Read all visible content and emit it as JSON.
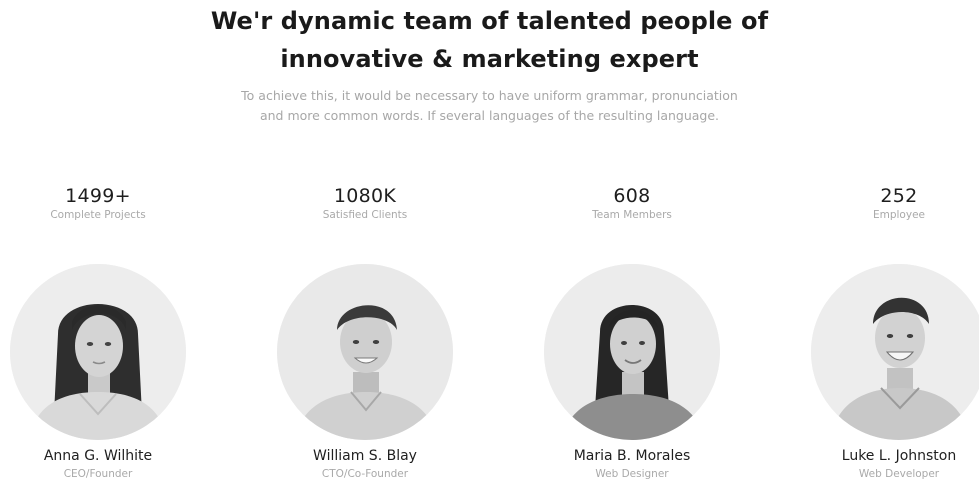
{
  "hero": {
    "title_line1": "We'r dynamic team of talented people of",
    "title_line2": "innovative & marketing expert",
    "subtitle_line1": "To achieve this, it would be necessary to have uniform grammar, pronunciation",
    "subtitle_line2": "and more common words. If several languages of the resulting language."
  },
  "stats": [
    {
      "value": "1499+",
      "label": "Complete Projects"
    },
    {
      "value": "1080K",
      "label": "Satisfied Clients"
    },
    {
      "value": "608",
      "label": "Team Members"
    },
    {
      "value": "252",
      "label": "Employee"
    }
  ],
  "team": [
    {
      "name": "Anna G. Wilhite",
      "role": "CEO/Founder"
    },
    {
      "name": "William S. Blay",
      "role": "CTO/Co-Founder"
    },
    {
      "name": "Maria B. Morales",
      "role": "Web Designer"
    },
    {
      "name": "Luke L. Johnston",
      "role": "Web Developer"
    }
  ],
  "colors": {
    "heading": "#1a1a1a",
    "muted": "#a7a7a7",
    "avatar_bg": "#ececec"
  }
}
